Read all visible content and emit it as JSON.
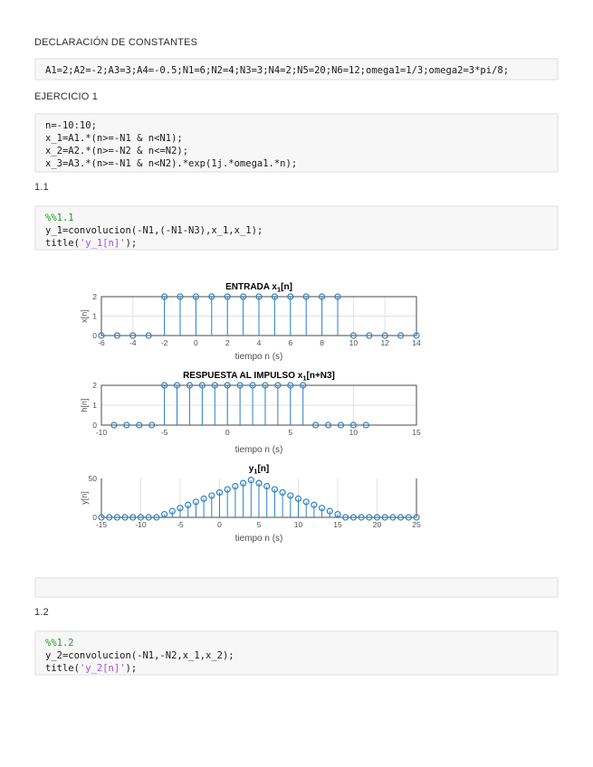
{
  "headings": {
    "constants": "DECLARACIÓN DE CONSTANTES",
    "ejercicio": "EJERCICIO 1",
    "sec11": "1.1",
    "sec12": "1.2"
  },
  "colors": {
    "code_background": "#f7f7f7",
    "code_border": "#ececec",
    "comment_green": "#229a22",
    "string_purple": "#aa4dd8",
    "stem_blue": "#2980c4",
    "axis_gray": "#4a4a4a",
    "grid_gray": "#e2e2e2",
    "tick_label_gray": "#4f4f4f"
  },
  "code_blocks": [
    {
      "name": "constants",
      "lines": [
        [
          {
            "t": "A1=2;A2=-2;A3=3;A4=-0.5;N1=6;N2=4;N3=3;N4=2;N5=20;N6=12;omega1=1/3;omega2=3*pi/8;",
            "c": "code"
          }
        ]
      ]
    },
    {
      "name": "signal-definitions",
      "lines": [
        [
          {
            "t": "n=-10:10;",
            "c": "code"
          }
        ],
        [
          {
            "t": "x_1=A1.*(n>=-N1 & n<N1);",
            "c": "code"
          }
        ],
        [
          {
            "t": "x_2=A2.*(n>=-N2 & n<=N2);",
            "c": "code"
          }
        ],
        [
          {
            "t": "x_3=A3.*(n>=-N1 & n<N2).*exp(1j.*omega1.*n);",
            "c": "code"
          }
        ]
      ]
    },
    {
      "name": "section-1-1",
      "lines": [
        [
          {
            "t": "%%1.1",
            "c": "comment"
          }
        ],
        [
          {
            "t": "y_1=convolucion(-N1,(-N1-N3),x_1,x_1);",
            "c": "code"
          }
        ],
        [
          {
            "t": "title(",
            "c": "code"
          },
          {
            "t": "'y_1[n]'",
            "c": "string"
          },
          {
            "t": ");",
            "c": "code"
          }
        ]
      ]
    },
    {
      "name": "empty-output",
      "lines": []
    },
    {
      "name": "section-1-2",
      "lines": [
        [
          {
            "t": "%%1.2",
            "c": "comment"
          }
        ],
        [
          {
            "t": "y_2=convolucion(-N1,-N2,x_1,x_2);",
            "c": "code"
          }
        ],
        [
          {
            "t": "title(",
            "c": "code"
          },
          {
            "t": "'y_2[n]'",
            "c": "string"
          },
          {
            "t": ");",
            "c": "code"
          }
        ]
      ]
    }
  ],
  "chart_data": [
    {
      "type": "stem",
      "title": "ENTRADA x_1[n]",
      "title_parts": [
        {
          "text": "ENTRADA x"
        },
        {
          "text": "1",
          "sub": true
        },
        {
          "text": "[n]"
        }
      ],
      "xlabel": "tiempo n (s)",
      "ylabel": "x[n]",
      "xlim": [
        -6,
        14
      ],
      "ylim": [
        0,
        2
      ],
      "xticks": [
        -6,
        -4,
        -2,
        0,
        2,
        4,
        6,
        8,
        10,
        12,
        14
      ],
      "yticks": [
        0,
        1,
        2
      ],
      "box": true,
      "grid": true,
      "x": [
        -6,
        -5,
        -4,
        -3,
        -2,
        -1,
        0,
        1,
        2,
        3,
        4,
        5,
        6,
        7,
        8,
        9,
        10,
        11,
        12,
        13,
        14
      ],
      "y": [
        0,
        0,
        0,
        0,
        2,
        2,
        2,
        2,
        2,
        2,
        2,
        2,
        2,
        2,
        2,
        2,
        0,
        0,
        0,
        0,
        0
      ]
    },
    {
      "type": "stem",
      "title": "RESPUESTA AL IMPULSO x_1[n+N3]",
      "title_parts": [
        {
          "text": "RESPUESTA AL IMPULSO x"
        },
        {
          "text": "1",
          "sub": true
        },
        {
          "text": "[n+N3]"
        }
      ],
      "xlabel": "tiempo n (s)",
      "ylabel": "h[n]",
      "xlim": [
        -10,
        15
      ],
      "ylim": [
        0,
        2
      ],
      "xticks": [
        -10,
        -5,
        0,
        5,
        10,
        15
      ],
      "yticks": [
        0,
        1,
        2
      ],
      "box": true,
      "grid": true,
      "x": [
        -9,
        -8,
        -7,
        -6,
        -5,
        -4,
        -3,
        -2,
        -1,
        0,
        1,
        2,
        3,
        4,
        5,
        6,
        7,
        8,
        9,
        10,
        11
      ],
      "y": [
        0,
        0,
        0,
        0,
        2,
        2,
        2,
        2,
        2,
        2,
        2,
        2,
        2,
        2,
        2,
        2,
        0,
        0,
        0,
        0,
        0
      ]
    },
    {
      "type": "stem",
      "title": "y_1[n]",
      "title_parts": [
        {
          "text": "y"
        },
        {
          "text": "1",
          "sub": true
        },
        {
          "text": "[n]"
        }
      ],
      "xlabel": "tiempo n (s)",
      "ylabel": "y[n]",
      "xlim": [
        -15,
        25
      ],
      "ylim": [
        0,
        50
      ],
      "xticks": [
        -15,
        -10,
        -5,
        0,
        5,
        10,
        15,
        20,
        25
      ],
      "yticks": [
        0,
        50
      ],
      "box": false,
      "grid": true,
      "x": [
        -15,
        -14,
        -13,
        -12,
        -11,
        -10,
        -9,
        -8,
        -7,
        -6,
        -5,
        -4,
        -3,
        -2,
        -1,
        0,
        1,
        2,
        3,
        4,
        5,
        6,
        7,
        8,
        9,
        10,
        11,
        12,
        13,
        14,
        15,
        16,
        17,
        18,
        19,
        20,
        21,
        22,
        23,
        24,
        25
      ],
      "y": [
        0,
        0,
        0,
        0,
        0,
        0,
        0,
        0,
        4,
        8,
        12,
        16,
        20,
        24,
        28,
        32,
        36,
        40,
        44,
        48,
        44,
        40,
        36,
        32,
        28,
        24,
        20,
        16,
        12,
        8,
        4,
        0,
        0,
        0,
        0,
        0,
        0,
        0,
        0,
        0,
        0
      ]
    }
  ]
}
